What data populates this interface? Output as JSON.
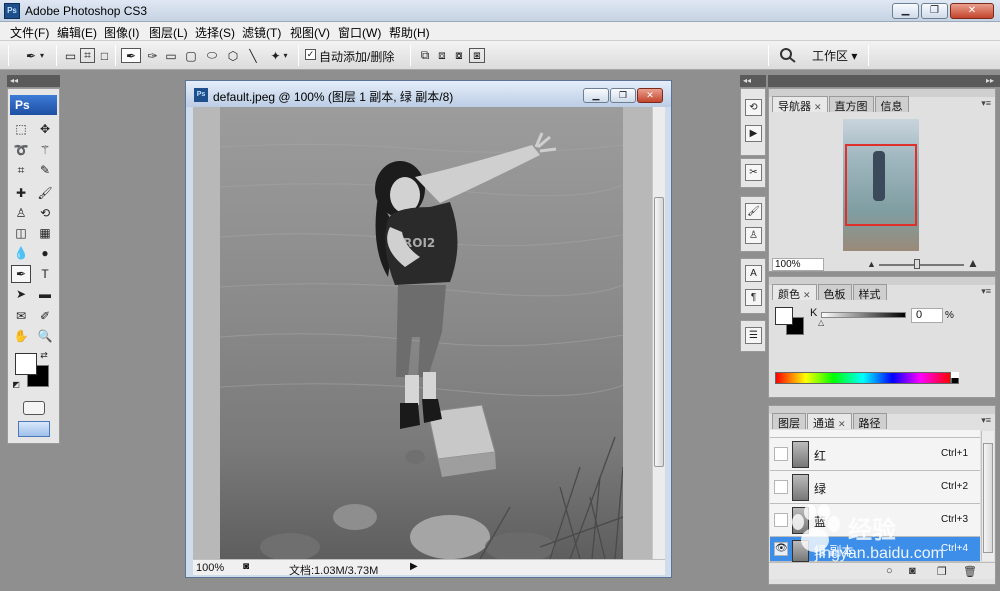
{
  "app": {
    "title": "Adobe Photoshop CS3",
    "icon_text": "Ps",
    "window_buttons": [
      "minimize",
      "restore",
      "close"
    ]
  },
  "menu": {
    "items": [
      "文件(F)",
      "编辑(E)",
      "图像(I)",
      "图层(L)",
      "选择(S)",
      "滤镜(T)",
      "视图(V)",
      "窗口(W)",
      "帮助(H)"
    ]
  },
  "options_bar": {
    "auto_add_label": "自动添加/删除",
    "auto_add_checked": true,
    "workspace_label": "工作区 ▾",
    "icons": [
      "pen-tool-icon",
      "shape-layers-icon",
      "paths-icon",
      "fill-pixels-icon",
      "pen-icon",
      "freeform-pen-icon",
      "rectangle-icon",
      "rounded-rectangle-icon",
      "ellipse-icon",
      "polygon-icon",
      "line-icon",
      "custom-shape-icon"
    ]
  },
  "tools": {
    "logo": "Ps",
    "header_glyph": "◂◂"
  },
  "document": {
    "title": "default.jpeg @ 100% (图层 1 副本, 绿 副本/8)",
    "zoom": "100%",
    "doc_info": "文档:1.03M/3.73M"
  },
  "panels": {
    "header_glyph": "▸▸",
    "navigator": {
      "tabs": [
        "导航器",
        "直方图",
        "信息"
      ],
      "active_tab": 0,
      "zoom": "100%"
    },
    "color": {
      "tabs": [
        "颜色",
        "色板",
        "样式"
      ],
      "active_tab": 0,
      "channel_label": "K",
      "value": "0",
      "unit": "%",
      "value_fraction": 0.0
    },
    "channels": {
      "tabs": [
        "图层",
        "通道",
        "路径"
      ],
      "active_tab": 1,
      "rows": [
        {
          "name": "红",
          "shortcut": "Ctrl+1",
          "visible": false,
          "selected": false
        },
        {
          "name": "绿",
          "shortcut": "Ctrl+2",
          "visible": false,
          "selected": false
        },
        {
          "name": "蓝",
          "shortcut": "Ctrl+3",
          "visible": false,
          "selected": false
        },
        {
          "name": "绿 副本",
          "shortcut": "Ctrl+4",
          "visible": true,
          "selected": true
        }
      ]
    }
  },
  "watermark": {
    "brand": "经验",
    "url": "jingyan.baidu.com"
  },
  "colors": {
    "selection_blue": "#3d8ee8",
    "nav_view_box": "#e0302b",
    "title_gradient_top": "#dfe8f3"
  }
}
